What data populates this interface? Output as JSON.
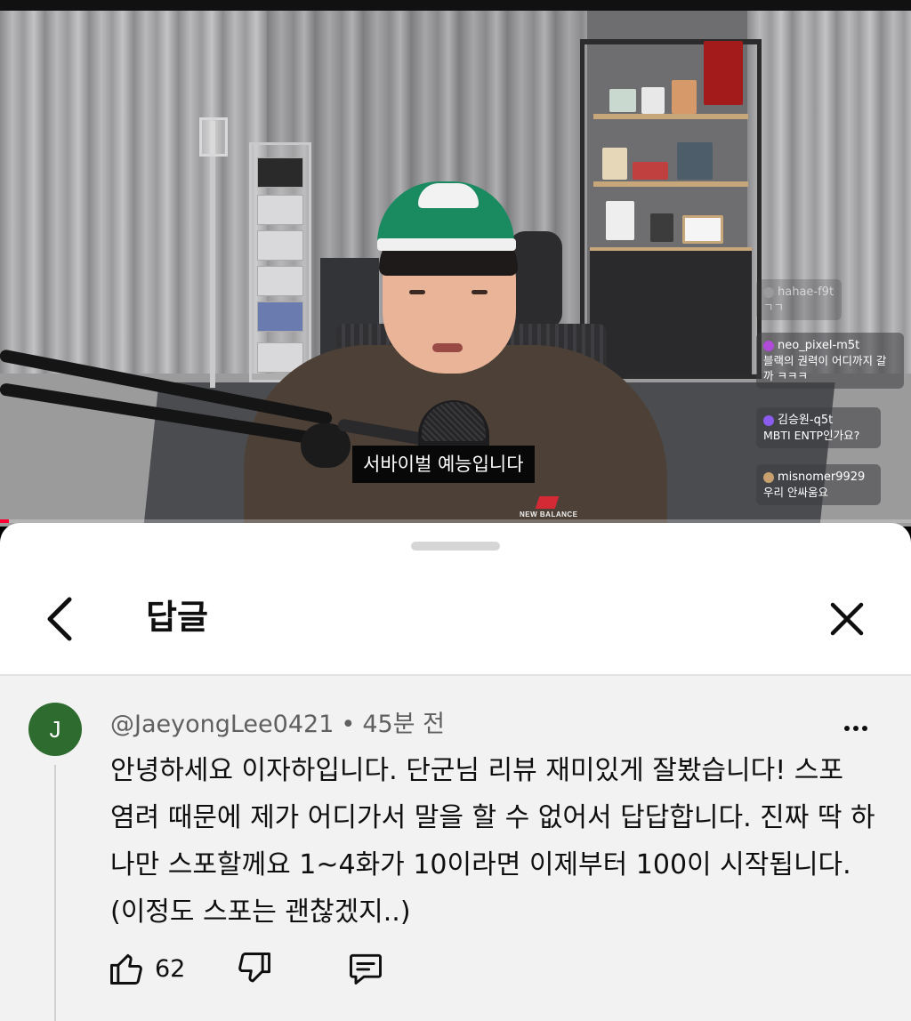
{
  "video": {
    "subtitle": "서바이벌 예능입니다",
    "shirt_brand": "NEW BALANCE",
    "progress_fraction": 0.01,
    "accent_color": "#ff0033",
    "live_chat": [
      {
        "user": "hahae-f9t",
        "text": "ㄱㄱ",
        "avatar_color": "#9a9a9a",
        "faded": true
      },
      {
        "user": "neo_pixel-m5t",
        "text": "블랙의 권력이 어디까지 갈\n까 ㅋㅋㅋ",
        "avatar_color": "#b04ad8",
        "faded": false
      },
      {
        "user": "김승원-q5t",
        "text": "MBTI ENTP인가요?",
        "avatar_color": "#8a5cf0",
        "faded": false
      },
      {
        "user": "misnomer9929",
        "text": "우리 안싸움요",
        "avatar_color": "#c8a070",
        "faded": false
      }
    ]
  },
  "sheet": {
    "title": "답글",
    "back_icon": "chevron-left-icon",
    "close_icon": "close-icon"
  },
  "comment": {
    "avatar_letter": "J",
    "avatar_color": "#2e6b2e",
    "author": "@JaeyongLee0421",
    "separator": "•",
    "time": "45분 전",
    "body": "안녕하세요 이자하입니다. 단군님 리뷰 재미있게 잘봤습니다! 스포 염려 때문에 제가 어디가서 말을 할 수 없어서 답답합니다. 진짜 딱 하나만 스포할께요 1~4화가 10이라면 이제부터 100이 시작됩니다. (이정도 스포는 괜찮겠지..)",
    "likes": "62",
    "icons": {
      "like": "thumbs-up-icon",
      "dislike": "thumbs-down-icon",
      "reply": "reply-icon",
      "more": "more-vertical-icon"
    }
  }
}
